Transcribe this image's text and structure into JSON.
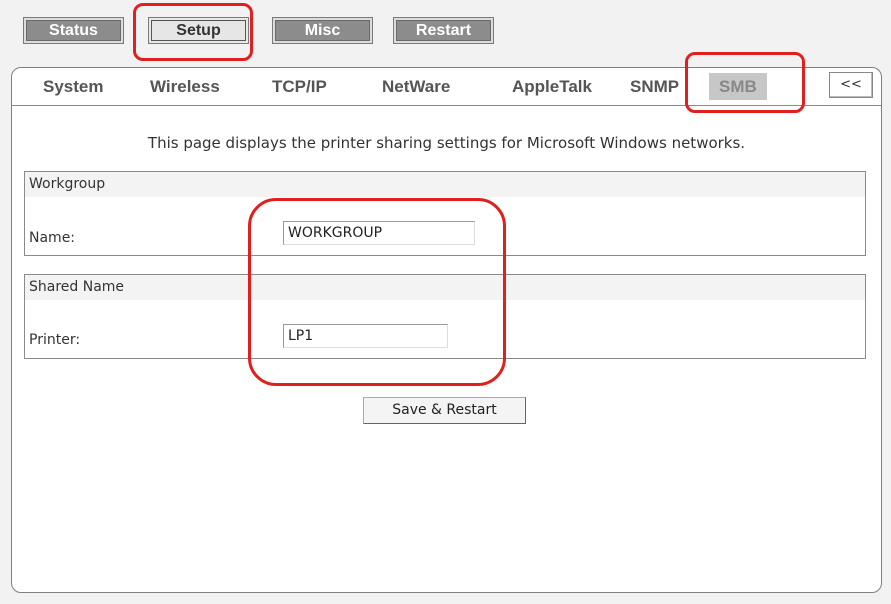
{
  "top_tabs": [
    {
      "label": "Status",
      "active": false
    },
    {
      "label": "Setup",
      "active": true
    },
    {
      "label": "Misc",
      "active": false
    },
    {
      "label": "Restart",
      "active": false
    }
  ],
  "sub_tabs": [
    {
      "label": "System"
    },
    {
      "label": "Wireless"
    },
    {
      "label": "TCP/IP"
    },
    {
      "label": "NetWare"
    },
    {
      "label": "AppleTalk"
    },
    {
      "label": "SNMP"
    },
    {
      "label": "SMB",
      "active": true
    }
  ],
  "collapse_button": "<<",
  "intro_text": "This page displays the printer sharing settings for Microsoft Windows networks.",
  "workgroup": {
    "title": "Workgroup",
    "name_label": "Name:",
    "name_value": "WORKGROUP"
  },
  "shared_name": {
    "title": "Shared Name",
    "printer_label": "Printer:",
    "printer_value": "LP1"
  },
  "save_button": "Save & Restart",
  "colors": {
    "annotation": "#e0201f",
    "tab_inactive": "#8c8c8c",
    "subtab_active": "#c7c7c7"
  }
}
